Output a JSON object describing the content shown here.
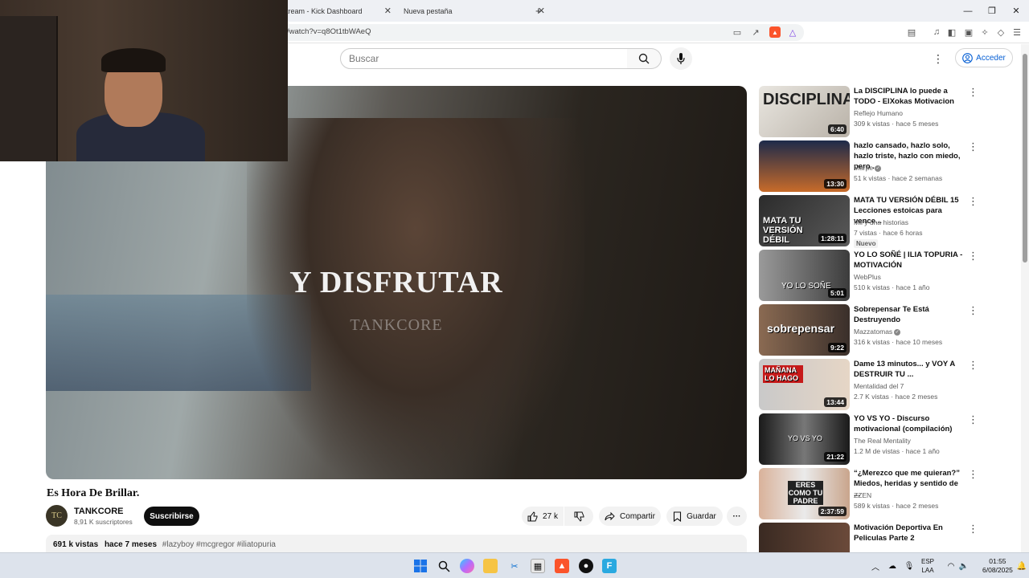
{
  "browser": {
    "tabs": [
      {
        "label": "tream - Kick Dashboard"
      },
      {
        "label": "Nueva pestaña"
      }
    ],
    "new_tab": "+",
    "url": "/watch?v=q8Ot1tbWAeQ",
    "window_controls": {
      "minimize": "—",
      "restore": "❐",
      "close": "✕"
    }
  },
  "youtube": {
    "search_placeholder": "Buscar",
    "signin_label": "Acceder",
    "more": "⋮"
  },
  "player": {
    "caption_main": "Y DISFRUTAR",
    "caption_watermark": "TANKCORE"
  },
  "video": {
    "title": "Es Hora De Brillar.",
    "channel_initials": "TC",
    "channel_name": "TANKCORE",
    "subscribers": "8,91 K suscriptores",
    "subscribe_label": "Suscribirse",
    "likes": "27 k",
    "share_label": "Compartir",
    "save_label": "Guardar",
    "more_label": "···",
    "views": "691 k vistas",
    "age": "hace 7 meses",
    "tags": "#lazyboy #mcgregor #iliatopuria"
  },
  "sidebar": [
    {
      "title": "La DISCIPLINA lo puede a TODO - ElXokas Motivacion",
      "channel": "Reflejo Humano",
      "meta": "309 k vistas · hace 5 meses",
      "duration": "6:40",
      "thumb_text": "DISCIPLINA",
      "verified": false,
      "badge": ""
    },
    {
      "title": "hazlo cansado, hazlo solo, hazlo triste, hazlo con miedo, pero ...",
      "channel": "Marpe",
      "meta": "51 k vistas · hace 2 semanas",
      "duration": "13:30",
      "thumb_text": "",
      "verified": true,
      "badge": ""
    },
    {
      "title": "MATA TU VERSIÓN DÉBIL 15 Lecciones estoicas para vence...",
      "channel": "Mil y una historias",
      "meta": "7 vistas · hace 6 horas",
      "duration": "1:28:11",
      "thumb_text": "MATA TU VERSIÓN DÉBIL",
      "verified": false,
      "badge": "Nuevo"
    },
    {
      "title": "YO LO SOÑÉ | ILIA TOPURIA - MOTIVACIÓN",
      "channel": "WebPlus",
      "meta": "510 k vistas · hace 1 año",
      "duration": "5:01",
      "thumb_text": "YO LO SOÑE",
      "verified": false,
      "badge": ""
    },
    {
      "title": "Sobrepensar Te Está Destruyendo",
      "channel": "Mazzatomas",
      "meta": "316 k vistas · hace 10 meses",
      "duration": "9:22",
      "thumb_text": "sobrepensar",
      "verified": true,
      "badge": ""
    },
    {
      "title": "Dame 13 minutos... y VOY A DESTRUIR TU ...",
      "channel": "Mentalidad del 7",
      "meta": "2.7 K vistas · hace 2 meses",
      "duration": "13:44",
      "thumb_text": "MAÑANA LO HAGO",
      "verified": false,
      "badge": ""
    },
    {
      "title": "YO VS YO - Discurso motivacional (compilación)",
      "channel": "The Real Mentality",
      "meta": "1.2 M de vistas · hace 1 año",
      "duration": "21:22",
      "thumb_text": "YO VS YO",
      "verified": false,
      "badge": ""
    },
    {
      "title": "“¿Merezco que me quieran?” Miedos, heridas y sentido de ...",
      "channel": "ZZEN",
      "meta": "589 k vistas · hace 2 meses",
      "duration": "2:37:59",
      "thumb_text": "ERES COMO TU PADRE",
      "verified": false,
      "badge": ""
    },
    {
      "title": "Motivación Deportiva En Peliculas Parte 2",
      "channel": "",
      "meta": "",
      "duration": "",
      "thumb_text": "",
      "verified": false,
      "badge": ""
    }
  ],
  "taskbar": {
    "lang_top": "ESP",
    "lang_bottom": "LAA",
    "time": "01:55",
    "date": "6/08/2025"
  }
}
